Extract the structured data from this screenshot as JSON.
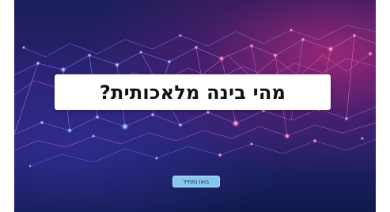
{
  "slide": {
    "title": "מהי בינה מלאכותית?",
    "start_button_label": "בואו נתחיל",
    "background_image": "network-nodes-background"
  },
  "colors": {
    "background_dark": "#1b1f5a",
    "background_magenta": "#be2878",
    "title_box": "#ffffff",
    "title_text": "#111111",
    "button_fill": "#86c7ee",
    "button_text": "#13263a"
  }
}
